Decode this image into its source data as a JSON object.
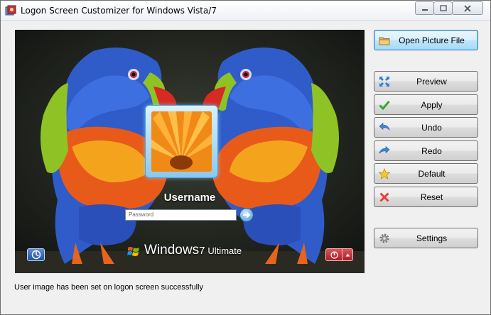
{
  "window": {
    "title": "Logon Screen Customizer for Windows Vista/7"
  },
  "preview": {
    "username": "Username",
    "password_placeholder": "Password",
    "brand_windows": "Windows",
    "brand_version": "7",
    "brand_edition": "Ultimate"
  },
  "buttons": {
    "open_picture": "Open Picture File",
    "preview": "Preview",
    "apply": "Apply",
    "undo": "Undo",
    "redo": "Redo",
    "default": "Default",
    "reset": "Reset",
    "settings": "Settings"
  },
  "status": "User image has been set on logon screen successfully",
  "colors": {
    "accent": "#3c7fb1",
    "power": "#c0282f",
    "ease": "#2a5db0"
  }
}
